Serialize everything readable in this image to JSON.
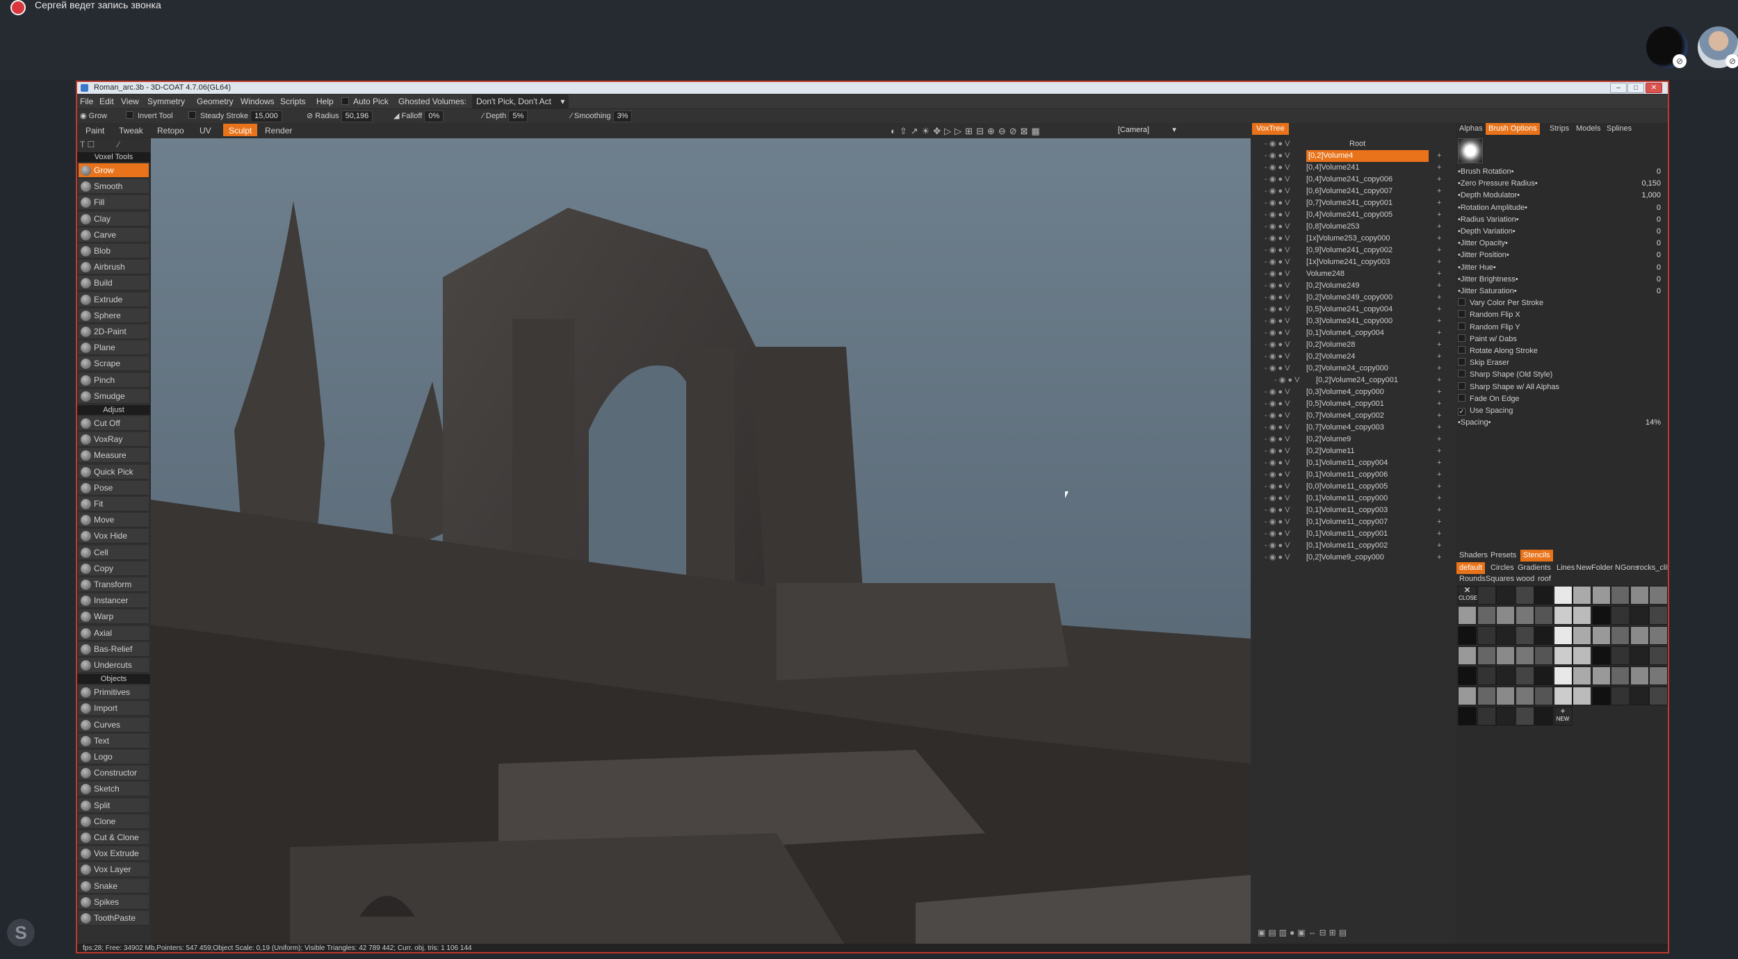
{
  "call": {
    "recording_text": "Сергей ведет запись звонка"
  },
  "window": {
    "title": "Roman_arc.3b - 3D-COAT 4.7.06(GL64)"
  },
  "menu": [
    "File",
    "Edit",
    "View",
    "Symmetry",
    "Geometry",
    "Windows",
    "Scripts",
    "Help"
  ],
  "menu_extra": {
    "auto_pick": "Auto Pick",
    "ghosted_label": "Ghosted Volumes:",
    "ghosted_value": "Don't Pick, Don't Act"
  },
  "toolbar": {
    "grow": "Grow",
    "invert_tool": "Invert Tool",
    "steady_stroke": "Steady Stroke",
    "steady_value": "15,000",
    "radius": "Radius",
    "radius_value": "50,196",
    "falloff": "Falloff",
    "falloff_value": "0%",
    "depth": "Depth",
    "depth_value": "5%",
    "smoothing": "Smoothing",
    "smoothing_value": "3%"
  },
  "rooms": [
    {
      "label": "Paint",
      "active": false
    },
    {
      "label": "Tweak",
      "active": false
    },
    {
      "label": "Retopo",
      "active": false
    },
    {
      "label": "UV",
      "active": false
    },
    {
      "label": "Sculpt",
      "active": true
    },
    {
      "label": "Render",
      "active": false
    }
  ],
  "camera_label": "[Camera]",
  "left_panel": {
    "voxel_tools_header": "Voxel Tools",
    "voxel_tools": [
      "Grow",
      "Smooth",
      "Fill",
      "Clay",
      "Carve",
      "Blob",
      "Airbrush",
      "Build",
      "Extrude",
      "Sphere",
      "2D-Paint",
      "Plane",
      "Scrape",
      "Pinch",
      "Smudge"
    ],
    "adjust_header": "Adjust",
    "adjust_tools": [
      "Cut Off",
      "VoxRay",
      "Measure",
      "Quick Pick",
      "Pose",
      "Fit",
      "Move",
      "Vox Hide",
      "Cell",
      "Copy",
      "Transform",
      "Instancer",
      "Warp",
      "Axial",
      "Bas-Relief",
      "Undercuts"
    ],
    "objects_header": "Objects",
    "object_tools": [
      "Primitives",
      "Import",
      "Curves",
      "Text",
      "Logo",
      "Constructor",
      "Sketch",
      "Split",
      "Clone",
      "Cut & Clone",
      "Vox Extrude",
      "Vox Layer",
      "Snake",
      "Spikes",
      "ToothPaste"
    ]
  },
  "voxtree": {
    "tab": "VoxTree",
    "root": "Root",
    "items": [
      "[0,2]Volume4",
      "[0,4]Volume241",
      "[0,4]Volume241_copy006",
      "[0,6]Volume241_copy007",
      "[0,7]Volume241_copy001",
      "[0,4]Volume241_copy005",
      "[0,8]Volume253",
      "[1x]Volume253_copy000",
      "[0,9]Volume241_copy002",
      "[1x]Volume241_copy003",
      "Volume248",
      "[0,2]Volume249",
      "[0,2]Volume249_copy000",
      "[0,5]Volume241_copy004",
      "[0,3]Volume241_copy000",
      "[0,1]Volume4_copy004",
      "[0,2]Volume28",
      "[0,2]Volume24",
      "[0,2]Volume24_copy000",
      "[0,2]Volume24_copy001",
      "[0,3]Volume4_copy000",
      "[0,5]Volume4_copy001",
      "[0,7]Volume4_copy002",
      "[0,7]Volume4_copy003",
      "[0,2]Volume9",
      "[0,2]Volume11",
      "[0,1]Volume11_copy004",
      "[0,1]Volume11_copy006",
      "[0,0]Volume11_copy005",
      "[0,1]Volume11_copy000",
      "[0,1]Volume11_copy003",
      "[0,1]Volume11_copy007",
      "[0,1]Volume11_copy001",
      "[0,1]Volume11_copy002",
      "[0,2]Volume9_copy000"
    ]
  },
  "right_panel": {
    "tabs": [
      {
        "label": "Alphas",
        "active": false
      },
      {
        "label": "Brush Options",
        "active": true
      },
      {
        "label": "Strips",
        "active": false
      },
      {
        "label": "Models",
        "active": false
      },
      {
        "label": "Splines",
        "active": false
      }
    ],
    "params": [
      {
        "label": "Brush Rotation",
        "value": "0"
      },
      {
        "label": "Zero Pressure Radius",
        "value": "0,150"
      },
      {
        "label": "Depth Modulator",
        "value": "1,000"
      },
      {
        "label": "Rotation Amplitude",
        "value": "0"
      },
      {
        "label": "Radius Variation",
        "value": "0"
      },
      {
        "label": "Depth Variation",
        "value": "0"
      },
      {
        "label": "Jitter Opacity",
        "value": "0"
      },
      {
        "label": "Jitter Position",
        "value": "0"
      },
      {
        "label": "Jitter Hue",
        "value": "0"
      },
      {
        "label": "Jitter Brightness",
        "value": "0"
      },
      {
        "label": "Jitter Saturation",
        "value": "0"
      }
    ],
    "checkboxes": [
      {
        "label": "Vary Color Per Stroke",
        "checked": false
      },
      {
        "label": "Random Flip X",
        "checked": false
      },
      {
        "label": "Random Flip Y",
        "checked": false
      },
      {
        "label": "Paint w/ Dabs",
        "checked": false
      },
      {
        "label": "Rotate Along Stroke",
        "checked": false
      },
      {
        "label": "Skip Eraser",
        "checked": false
      },
      {
        "label": "Sharp Shape (Old Style)",
        "checked": false
      },
      {
        "label": "Sharp Shape w/ All Alphas",
        "checked": false
      },
      {
        "label": "Fade On Edge",
        "checked": false
      },
      {
        "label": "Use Spacing",
        "checked": true
      }
    ],
    "spacing": {
      "label": "Spacing",
      "value": "14%"
    },
    "stencil_tabs": [
      {
        "label": "Shaders",
        "active": false
      },
      {
        "label": "Presets",
        "active": false
      },
      {
        "label": "Stencils",
        "active": true
      }
    ],
    "stencil_folders": [
      {
        "label": "default",
        "active": true
      },
      {
        "label": "Circles",
        "active": false
      },
      {
        "label": "Gradients",
        "active": false
      },
      {
        "label": "Lines",
        "active": false
      },
      {
        "label": "NewFolder",
        "active": false
      },
      {
        "label": "NGons",
        "active": false
      },
      {
        "label": "rocks_cliffs",
        "active": false
      },
      {
        "label": "roof",
        "active": false
      }
    ],
    "stencil_folders_row2": [
      "Rounds",
      "Squares",
      "wood"
    ],
    "close_label": "CLOSE",
    "new_label": "NEW"
  },
  "status": "fps:28;   Free: 34902 Mb,Pointers: 547 459;Object Scale: 0,19 (Uniform); Visible Triangles: 42 789 442; Curr. obj. tris: 1 106 144",
  "colors": {
    "accent": "#e8731a",
    "window_border": "#c0392b",
    "record": "#d9363e"
  }
}
